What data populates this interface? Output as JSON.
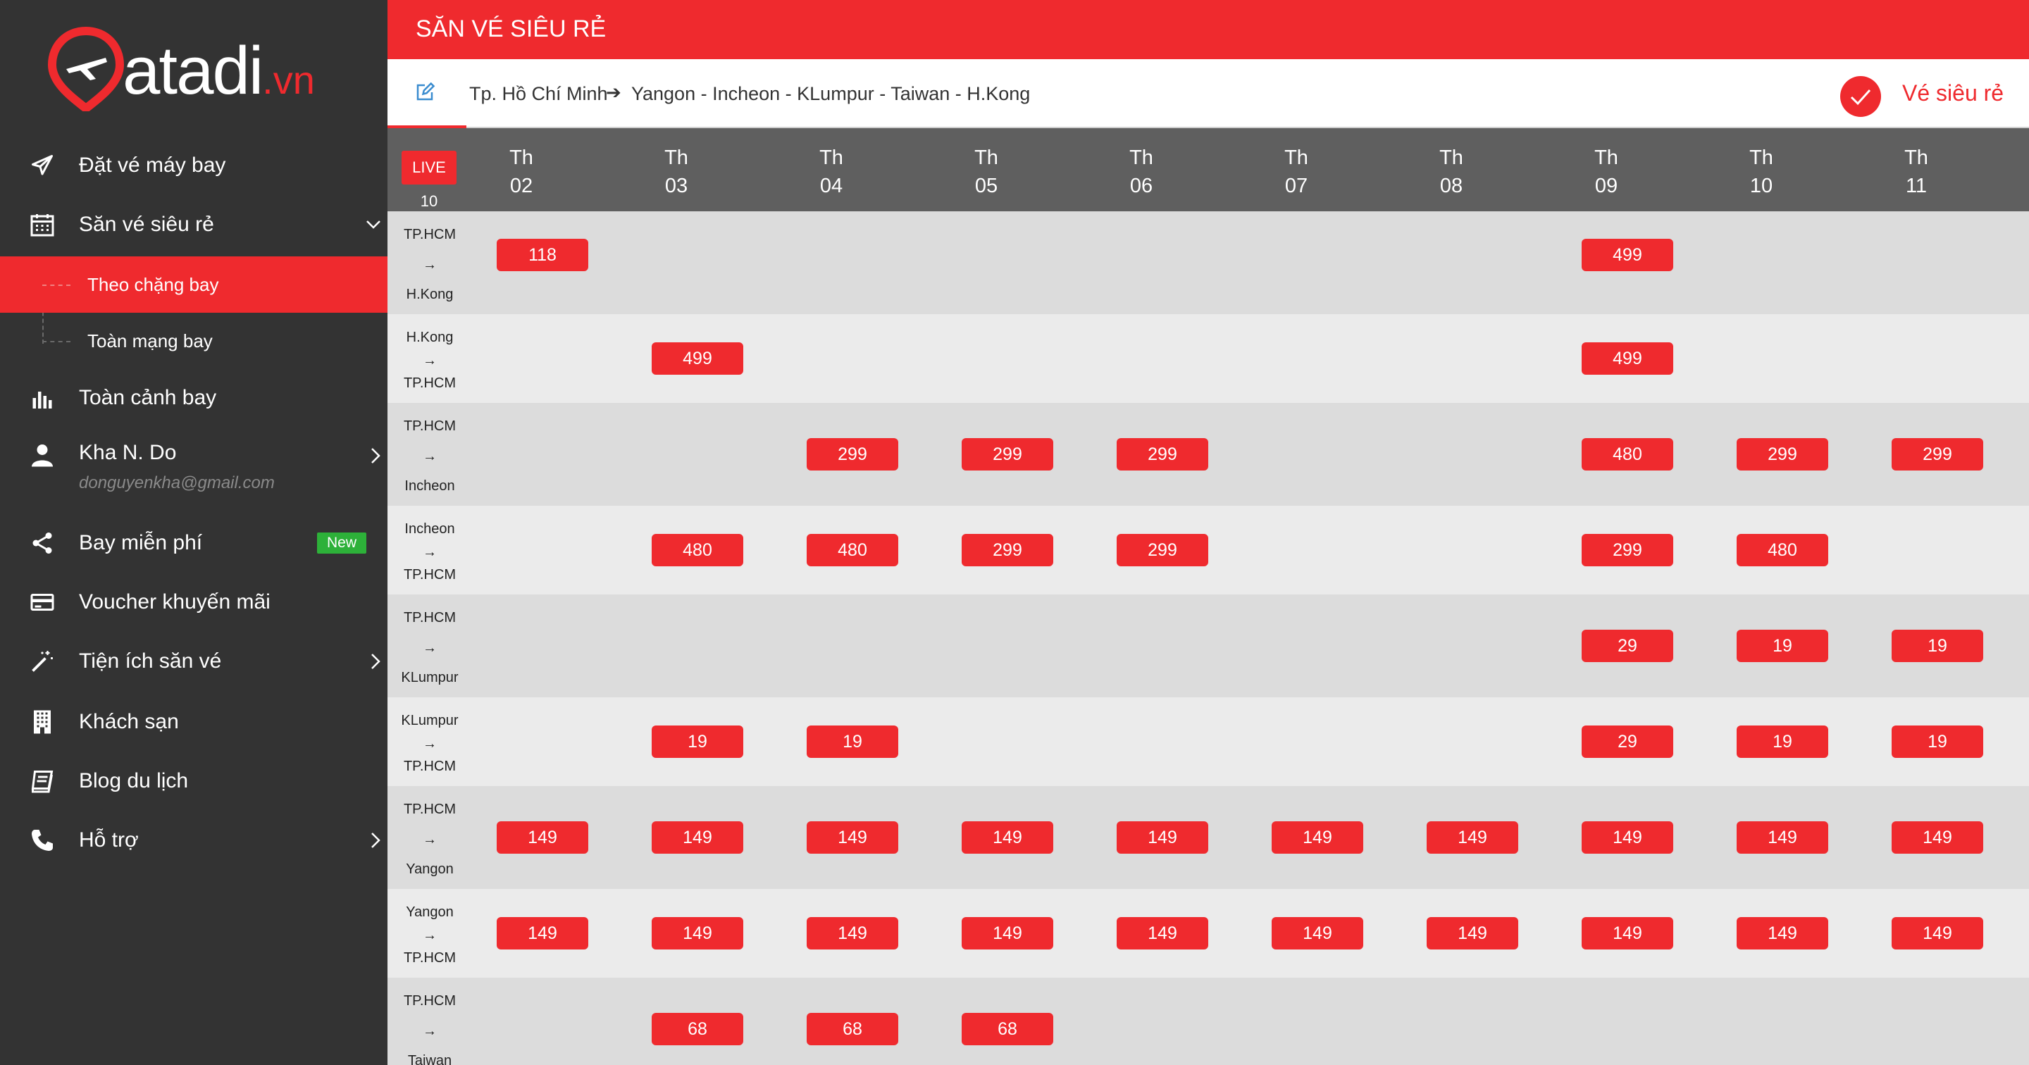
{
  "brand": {
    "name": "atadi",
    "suffix": ".vn"
  },
  "sidebar": {
    "items": [
      {
        "label": "Đặt vé máy bay",
        "icon": "paper-plane-icon"
      },
      {
        "label": "Săn vé siêu rẻ",
        "icon": "calendar-icon",
        "expanded": true
      },
      {
        "label": "Toàn cảnh bay",
        "icon": "bar-chart-icon"
      },
      {
        "label": "Kha N. Do",
        "sub": "donguyenkha@gmail.com",
        "icon": "user-icon"
      },
      {
        "label": "Bay miễn phí",
        "badge": "New",
        "icon": "share-icon"
      },
      {
        "label": "Voucher khuyến mãi",
        "icon": "card-icon"
      },
      {
        "label": "Tiện ích săn vé",
        "icon": "magic-wand-icon"
      },
      {
        "label": "Khách sạn",
        "icon": "building-icon"
      },
      {
        "label": "Blog du lịch",
        "icon": "book-icon"
      },
      {
        "label": "Hỗ trợ",
        "icon": "phone-icon"
      }
    ],
    "subitems": [
      {
        "label": "Theo chặng bay",
        "active": true
      },
      {
        "label": "Toàn mạng bay",
        "active": false
      }
    ]
  },
  "topbar": {
    "title": "SĂN VÉ SIÊU RẺ"
  },
  "route": {
    "origin": "Tp. Hồ Chí Minh",
    "arrow": "➔",
    "destinations": "Yangon - Incheon - KLumpur - Taiwan - H.Kong",
    "cheap_label": "Vé siêu rẻ"
  },
  "header": {
    "live": "LIVE 10",
    "month_prefix": "Th",
    "months": [
      "02",
      "03",
      "04",
      "05",
      "06",
      "07",
      "08",
      "09",
      "10",
      "11"
    ]
  },
  "colors": {
    "brand_red": "#ef2a2e",
    "sidebar": "#333333",
    "header": "#5f5f5f",
    "badge_green": "#2db139"
  },
  "rows": [
    {
      "from": "TP.HCM",
      "to": "H.Kong",
      "prices": [
        "118",
        "",
        "",
        "",
        "",
        "",
        "",
        "499",
        "",
        ""
      ]
    },
    {
      "from": "H.Kong",
      "to": "TP.HCM",
      "prices": [
        "",
        "499",
        "",
        "",
        "",
        "",
        "",
        "499",
        "",
        ""
      ]
    },
    {
      "from": "TP.HCM",
      "to": "Incheon",
      "prices": [
        "",
        "",
        "299",
        "299",
        "299",
        "",
        "",
        "480",
        "299",
        "299"
      ]
    },
    {
      "from": "Incheon",
      "to": "TP.HCM",
      "prices": [
        "",
        "480",
        "480",
        "299",
        "299",
        "",
        "",
        "299",
        "480",
        ""
      ]
    },
    {
      "from": "TP.HCM",
      "to": "KLumpur",
      "prices": [
        "",
        "",
        "",
        "",
        "",
        "",
        "",
        "29",
        "19",
        "19"
      ]
    },
    {
      "from": "KLumpur",
      "to": "TP.HCM",
      "prices": [
        "",
        "19",
        "19",
        "",
        "",
        "",
        "",
        "29",
        "19",
        "19"
      ]
    },
    {
      "from": "TP.HCM",
      "to": "Yangon",
      "prices": [
        "149",
        "149",
        "149",
        "149",
        "149",
        "149",
        "149",
        "149",
        "149",
        "149"
      ]
    },
    {
      "from": "Yangon",
      "to": "TP.HCM",
      "prices": [
        "149",
        "149",
        "149",
        "149",
        "149",
        "149",
        "149",
        "149",
        "149",
        "149"
      ]
    },
    {
      "from": "TP.HCM",
      "to": "Taiwan",
      "prices": [
        "",
        "68",
        "68",
        "68",
        "",
        "",
        "",
        "",
        "",
        ""
      ]
    }
  ]
}
